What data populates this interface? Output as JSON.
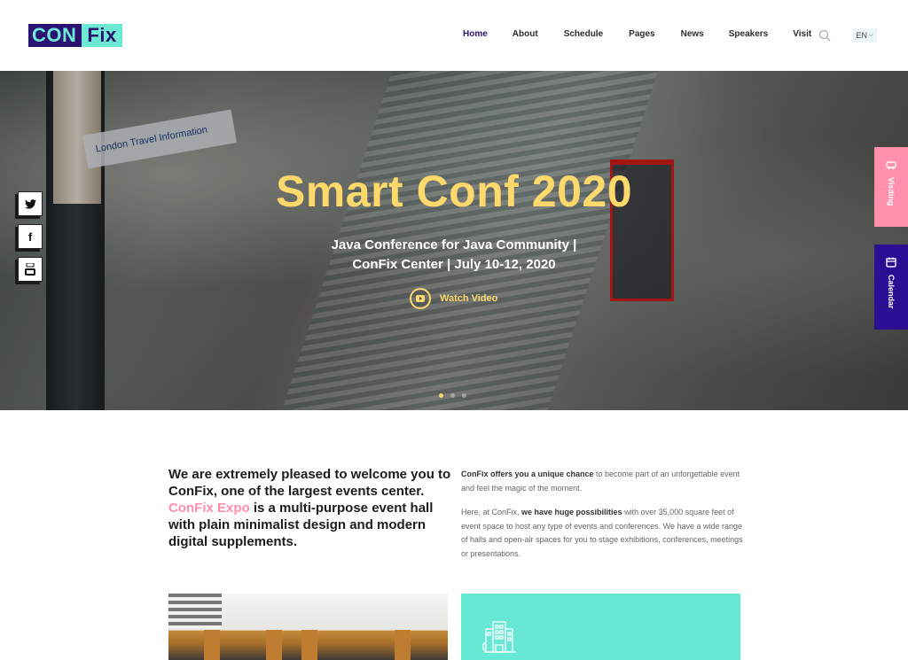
{
  "header": {
    "logo": {
      "part1": "CON",
      "part2": "Fix"
    },
    "nav": [
      {
        "label": "Home",
        "active": true
      },
      {
        "label": "About",
        "active": false
      },
      {
        "label": "Schedule",
        "active": false
      },
      {
        "label": "Pages",
        "active": false
      },
      {
        "label": "News",
        "active": false
      },
      {
        "label": "Speakers",
        "active": false
      },
      {
        "label": "Visit",
        "active": false
      }
    ],
    "search_icon": "search-icon",
    "language": "EN",
    "language_icon": "chevron-down-icon"
  },
  "hero": {
    "title": "Smart Conf 2020",
    "subtitle_line1": "Java Conference for Java Community |",
    "subtitle_line2": "ConFix Center | July 10-12, 2020",
    "watch_video_label": "Watch Video",
    "slides_count": 3,
    "active_slide": 1,
    "background_sign_text": "London Travel Information"
  },
  "social": [
    {
      "name": "twitter",
      "icon": "twitter-icon",
      "glyph": "🐦"
    },
    {
      "name": "facebook",
      "icon": "facebook-icon",
      "glyph": "f"
    },
    {
      "name": "youtube",
      "icon": "youtube-icon",
      "glyph": "▶"
    }
  ],
  "side_tabs": [
    {
      "label": "Visiting",
      "icon": "car-icon"
    },
    {
      "label": "Calendar",
      "icon": "calendar-icon"
    }
  ],
  "intro": {
    "left_part1": "We are extremely pleased to welcome you to ConFix, one of the largest events center. ",
    "left_highlight": "ConFix Expo",
    "left_part2": " is a multi-purpose event hall with plain minimalist design and modern digital supplements.",
    "right_p1_bold": "ConFix offers you a unique chance",
    "right_p1_rest": " to become part of an unforgettable event and feel the magic of the moment.",
    "right_p2_start": "Here, at ConFix, ",
    "right_p2_bold": "we have huge possibilities",
    "right_p2_rest": " with over 35,000 square feet of event space to host any type of events and conferences. We have a wide range of halls and open-air spaces for you to stage exhibitions, conferences, meetings or presentations."
  },
  "cards": {
    "teal_icon": "building-icon"
  },
  "colors": {
    "brand_dark": "#2a1370",
    "brand_teal": "#6ee9d4",
    "accent_yellow": "#fcd96a",
    "accent_pink": "#ff8fab",
    "calendar_purple": "#2a0f95"
  }
}
